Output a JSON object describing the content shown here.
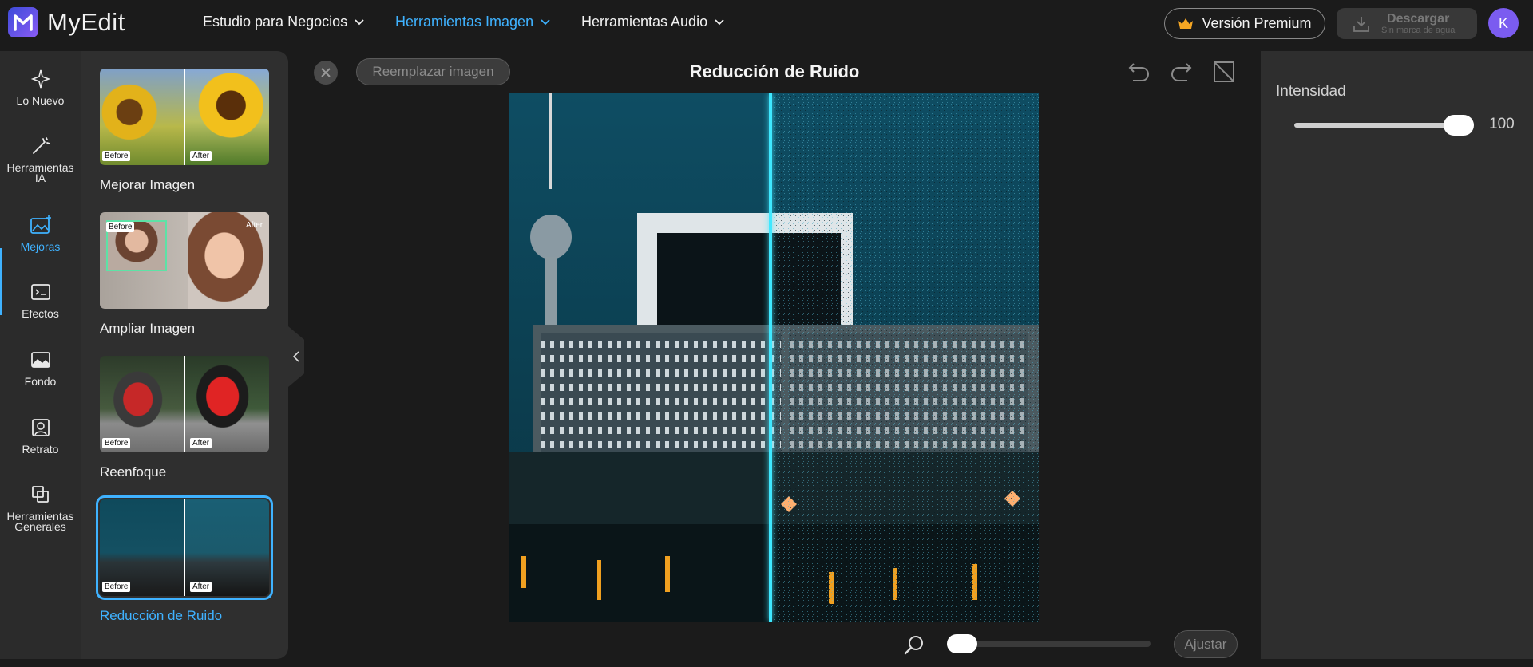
{
  "app": {
    "name": "MyEdit"
  },
  "nav": [
    {
      "label": "Estudio para Negocios",
      "active": false
    },
    {
      "label": "Herramientas Imagen",
      "active": true
    },
    {
      "label": "Herramientas Audio",
      "active": false
    }
  ],
  "header": {
    "premium_label": "Versión Premium",
    "download_label": "Descargar",
    "download_sub": "Sin marca de agua",
    "avatar_initial": "K"
  },
  "rail": [
    {
      "label": "Lo Nuevo",
      "icon": "sparkle-icon"
    },
    {
      "label": "Herramientas IA",
      "icon": "magic-wand-icon"
    },
    {
      "label": "Mejoras",
      "icon": "image-enhance-icon",
      "active": true
    },
    {
      "label": "Efectos",
      "icon": "effects-icon"
    },
    {
      "label": "Fondo",
      "icon": "background-icon"
    },
    {
      "label": "Retrato",
      "icon": "portrait-icon"
    },
    {
      "label": "Herramientas Generales",
      "icon": "general-tools-icon"
    }
  ],
  "tools": [
    {
      "label": "Mejorar Imagen",
      "before": "Before",
      "after": "After"
    },
    {
      "label": "Ampliar Imagen",
      "before": "Before",
      "after": "After"
    },
    {
      "label": "Reenfoque",
      "before": "Before",
      "after": "After"
    },
    {
      "label": "Reducción de Ruido",
      "before": "Before",
      "after": "After",
      "active": true
    }
  ],
  "canvas": {
    "replace_label": "Reemplazar imagen",
    "title": "Reducción de Ruido",
    "fit_label": "Ajustar"
  },
  "settings": {
    "intensity_label": "Intensidad",
    "intensity_value": "100"
  },
  "colors": {
    "accent": "#3fb2ff",
    "compare_line": "#3fe8ff"
  }
}
